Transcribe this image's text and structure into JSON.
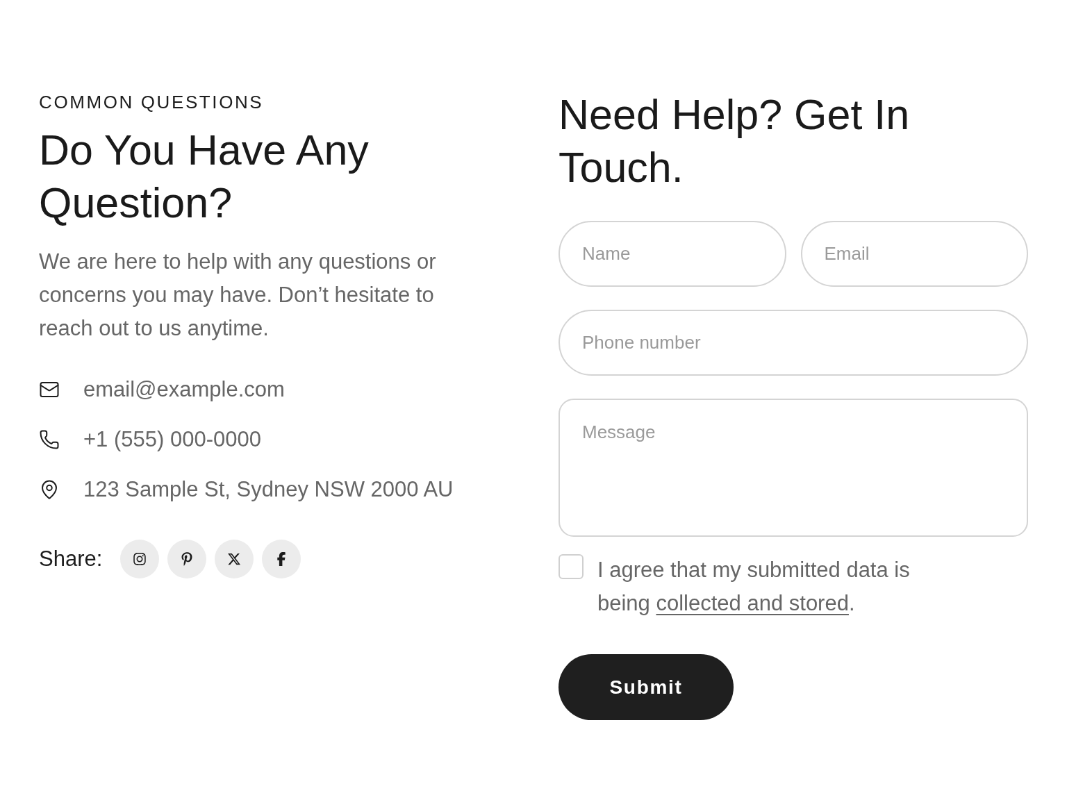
{
  "faq": {
    "eyebrow": "COMMON QUESTIONS",
    "title": "Do You Have Any Question?",
    "description": "We are here to help with any questions or concerns you may have. Don’t hesitate to reach out to us anytime.",
    "contacts": [
      {
        "kind": "email",
        "text": "email@example.com"
      },
      {
        "kind": "phone",
        "text": "+1 (555) 000-0000"
      },
      {
        "kind": "address",
        "text": "123 Sample St, Sydney NSW 2000 AU"
      }
    ],
    "share": {
      "label": "Share:",
      "links": [
        {
          "kind": "instagram"
        },
        {
          "kind": "pinterest"
        },
        {
          "kind": "x"
        },
        {
          "kind": "facebook"
        }
      ]
    }
  },
  "form": {
    "title": "Need Help? Get In Touch.",
    "rows": [
      [
        {
          "kind": "input",
          "placeholder": "Name"
        },
        {
          "kind": "input",
          "placeholder": "Email"
        }
      ],
      [
        {
          "kind": "input",
          "placeholder": "Phone number"
        }
      ],
      [
        {
          "kind": "textarea",
          "placeholder": "Message"
        }
      ]
    ],
    "consent": {
      "checked": false,
      "text": "I agree that my submitted data is being ",
      "link": "collected and stored",
      "after": "."
    },
    "submit": "Submit"
  }
}
